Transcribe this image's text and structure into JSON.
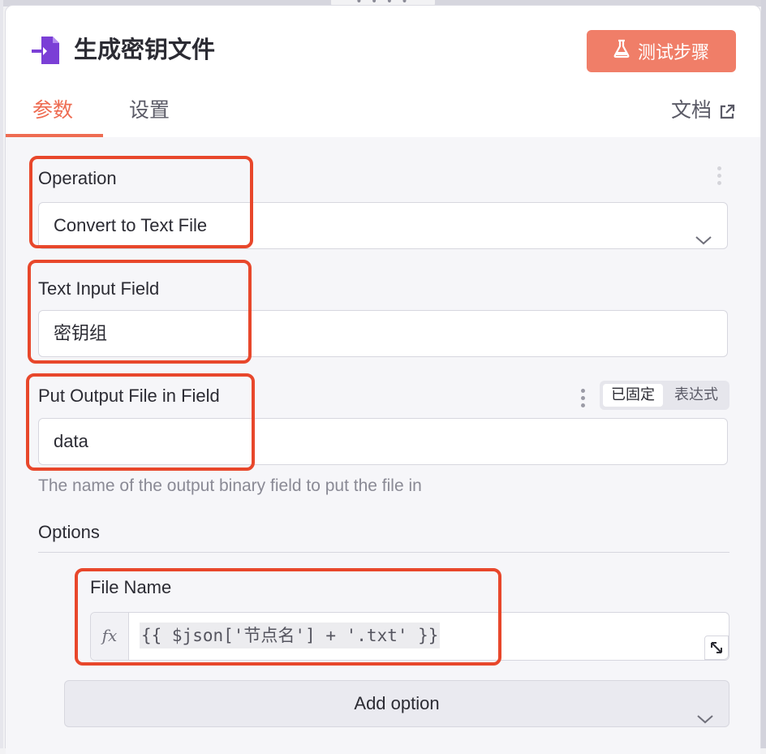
{
  "header": {
    "title": "生成密钥文件",
    "test_button_label": "测试步骤",
    "accent_color": "#f07e68"
  },
  "tabs": [
    {
      "label": "参数",
      "active": true
    },
    {
      "label": "设置",
      "active": false
    }
  ],
  "docs_link_label": "文档",
  "fields": {
    "operation": {
      "label": "Operation",
      "value": "Convert to Text File"
    },
    "text_input": {
      "label": "Text Input Field",
      "value": "密钥组"
    },
    "output_field": {
      "label": "Put Output File in Field",
      "value": "data",
      "hint": "The name of the output binary field to put the file in",
      "mode_toggle": {
        "fixed": "已固定",
        "expression": "表达式",
        "selected": "fixed"
      }
    }
  },
  "options": {
    "title": "Options",
    "file_name": {
      "label": "File Name",
      "fx_label": "fx",
      "expression": "{{ $json['节点名'] + '.txt' }}"
    },
    "add_option_label": "Add option"
  },
  "highlight_color": "#e8472b",
  "icons": [
    "file-export-icon",
    "flask-icon",
    "external-link-icon",
    "chevron-down-icon",
    "kebab-menu-icon",
    "expand-icon"
  ]
}
